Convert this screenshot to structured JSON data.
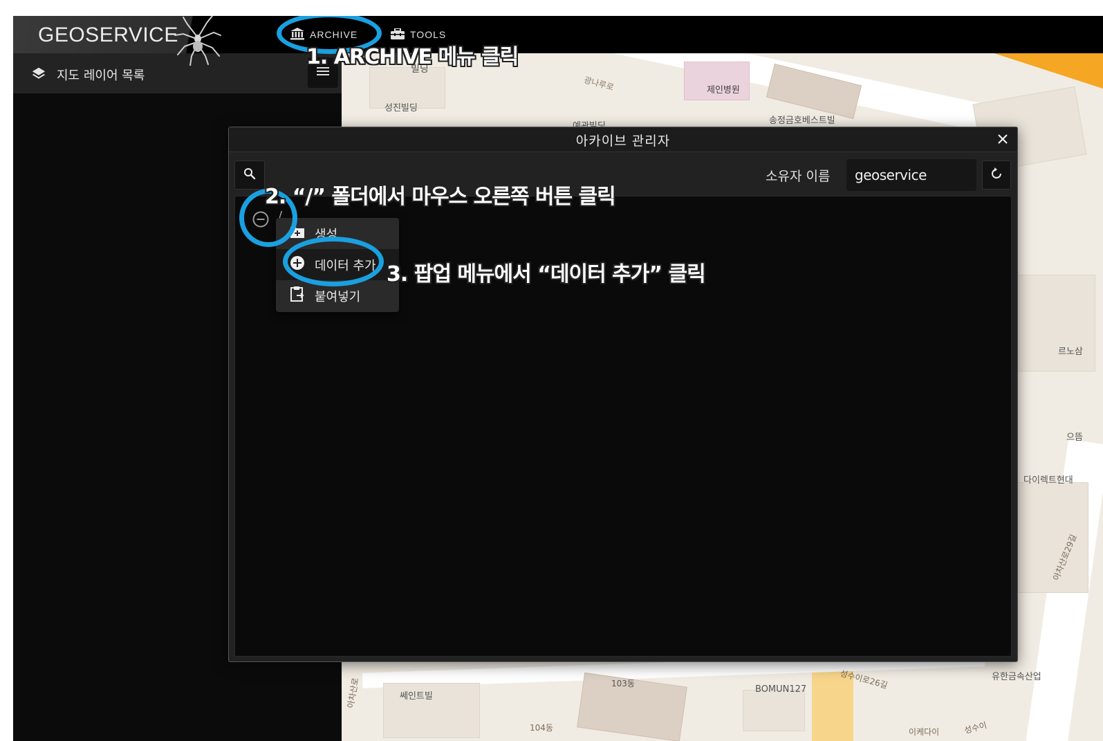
{
  "app": {
    "brand": "GEOSERVICE"
  },
  "topbar": {
    "menu": [
      {
        "label": "ARCHIVE",
        "icon": "bank-icon"
      },
      {
        "label": "TOOLS",
        "icon": "toolbox-icon"
      }
    ]
  },
  "sidebar": {
    "title": "지도 레이어 목록",
    "icon": "layers-icon"
  },
  "map": {
    "labels": [
      "빌딩",
      "광나루로",
      "제인병원",
      "성진빌딩",
      "예관빌딩",
      "송정금호베스트빌",
      "르노삼",
      "으뜸",
      "다이렉트현대",
      "아차산로29길",
      "유한금속산업",
      "쎄인트빌",
      "103동",
      "BOMUN127",
      "성수이로26길",
      "104동",
      "아차산로",
      "이케다이",
      "성수이"
    ]
  },
  "dialog": {
    "title": "아카이브 관리자",
    "owner_label": "소유자 이름",
    "owner_value": "geoservice",
    "tree_root": "/"
  },
  "context_menu": {
    "items": [
      {
        "label": "생성",
        "icon": "folder-add-icon"
      },
      {
        "label": "데이터 추가",
        "icon": "plus-circle-icon"
      },
      {
        "label": "붙여넣기",
        "icon": "paste-icon"
      }
    ]
  },
  "annotations": {
    "step1": "1. ARCHIVE 메뉴 클릭",
    "step2": "2. “/” 폴더에서 마우스 오른쪽 버튼 클릭",
    "step3": "3. 팝업 메뉴에서 “데이터 추가” 클릭"
  },
  "colors": {
    "highlight_ring": "#1aa0e0",
    "topbar_bg": "#000000",
    "dialog_bg": "#222222"
  }
}
